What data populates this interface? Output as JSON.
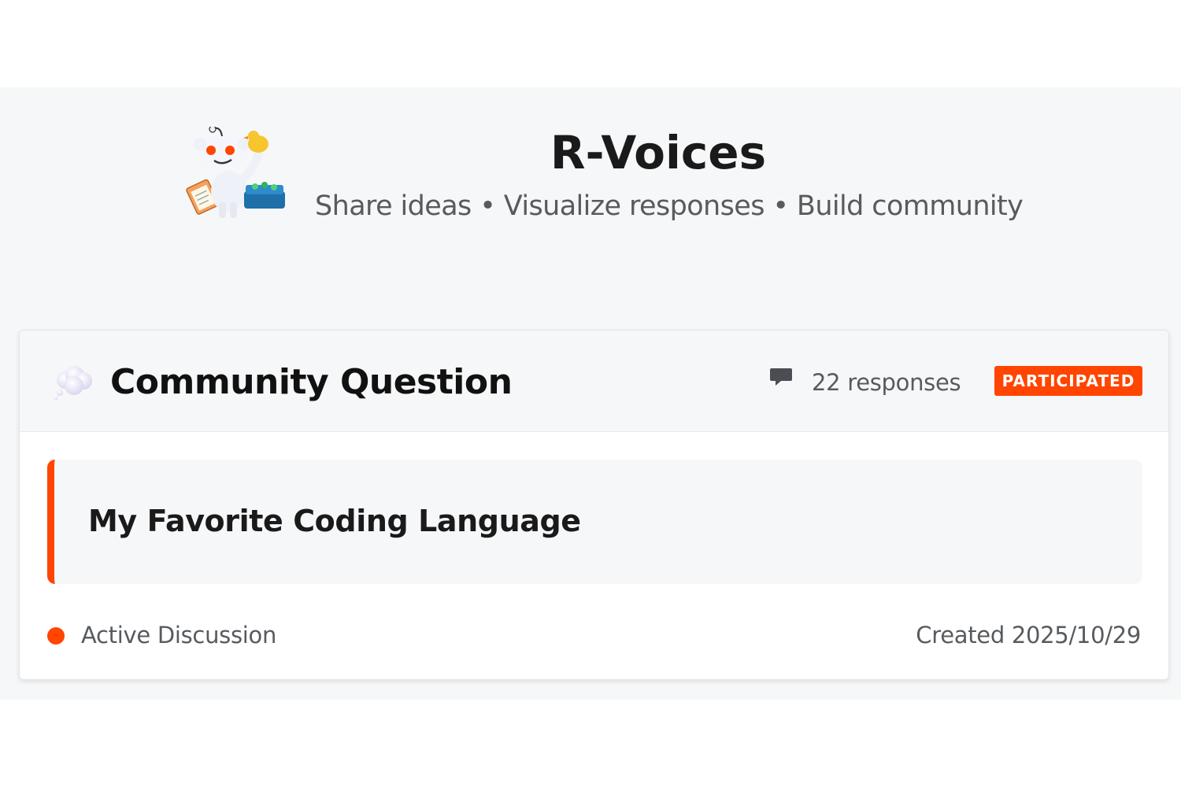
{
  "header": {
    "title": "R-Voices",
    "tagline": "Share ideas • Visualize responses • Build community",
    "mascot_icon": "snoo-mascot-icon"
  },
  "question_card": {
    "title": "Community Question",
    "title_icon": "thought-bubble-icon",
    "responses_icon": "comment-icon",
    "responses": "22 responses",
    "badge": "PARTICIPATED",
    "question": "My Favorite Coding Language",
    "status": "Active Discussion",
    "created": "Created 2025/10/29"
  },
  "colors": {
    "accent": "#ff4500",
    "background": "#f6f7f8",
    "card": "#ffffff",
    "muted_text": "#575b5f"
  }
}
